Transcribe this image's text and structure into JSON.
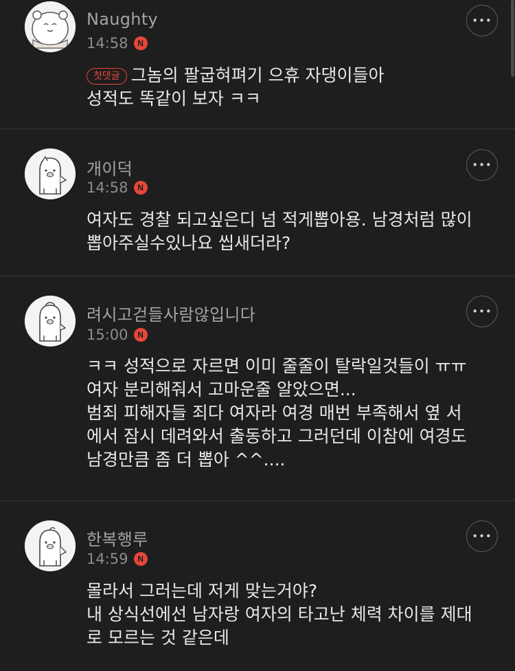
{
  "comments": [
    {
      "nickname": "Naughty",
      "time": "14:58",
      "badge": "N",
      "first_label": "첫댓글",
      "text": "그놈의 팔굽혀펴기 으휴 자댕이들아\n성적도 똑같이 보자 ㅋㅋ",
      "more_label": "•••"
    },
    {
      "nickname": "개이덕",
      "time": "14:58",
      "badge": "N",
      "text": "여자도 경찰 되고싶은디 넘 적게뽑아용. 남경처럼 많이\n뽑아주실수있나요 씹새더라?",
      "more_label": "•••"
    },
    {
      "nickname": "려시고걷들사람않입니다",
      "time": "15:00",
      "badge": "N",
      "text": "ㅋㅋ 성적으로 자르면 이미 줄줄이 탈락일것들이 ㅠㅠ\n여자 분리해줘서 고마운줄 알았으면...\n범죄 피해자들 죄다 여자라 여경 매번 부족해서 옆 서\n에서 잠시 데려와서 출동하고 그러던데 이참에 여경도\n남경만큼 좀 더 뽑아 ^^....",
      "more_label": "•••"
    },
    {
      "nickname": "한복행루",
      "time": "14:59",
      "badge": "N",
      "text": "몰라서 그러는데 저게 맞는거야?\n내 상식선에선 남자랑 여자의 타고난 체력 차이를 제대\n로 모르는 것 같은데",
      "more_label": "•••"
    }
  ]
}
